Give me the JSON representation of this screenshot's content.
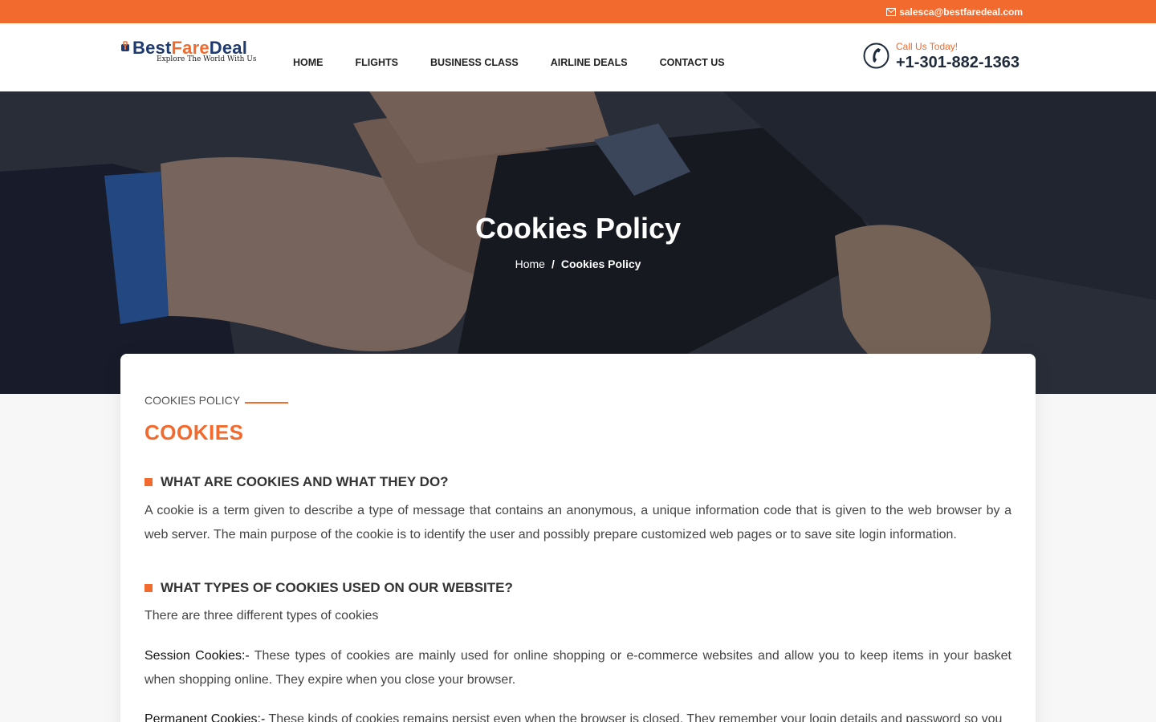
{
  "topbar": {
    "email": "salesca@bestfaredeal.com"
  },
  "logo": {
    "part1": "Best",
    "part2": "Fare",
    "part3": "Deal",
    "tagline": "Explore The World With Us"
  },
  "nav": [
    "HOME",
    "FLIGHTS",
    "BUSINESS CLASS",
    "AIRLINE DEALS",
    "CONTACT US"
  ],
  "call": {
    "label": "Call Us Today!",
    "number": "+1-301-882-1363"
  },
  "hero": {
    "title": "Cookies Policy",
    "crumb_home": "Home",
    "crumb_sep": "/",
    "crumb_current": "Cookies Policy"
  },
  "content": {
    "kicker": "COOKIES POLICY",
    "heading": "COOKIES",
    "q1": "WHAT ARE COOKIES AND WHAT THEY DO?",
    "p1": "A cookie is a term given to describe a type of message that contains an anonymous, a unique information code that is given to the web browser by a web server. The main purpose of the cookie is to identify the user and possibly prepare customized web pages or to save site login information.",
    "q2": "WHAT TYPES OF COOKIES USED ON OUR WEBSITE?",
    "p2": "There are three different types of cookies",
    "p3_lead": "Session Cookies:-",
    "p3": " These types of cookies are mainly used for online shopping or e-commerce websites and allow you to keep items in your basket when shopping online. They expire when you close your browser.",
    "p4_lead": "Permanent Cookies:-",
    "p4": " These kinds of cookies remains persist even when the browser is closed. They remember your login details and password so you"
  },
  "colors": {
    "accent": "#f26a2e",
    "navy": "#1e3a6e"
  }
}
